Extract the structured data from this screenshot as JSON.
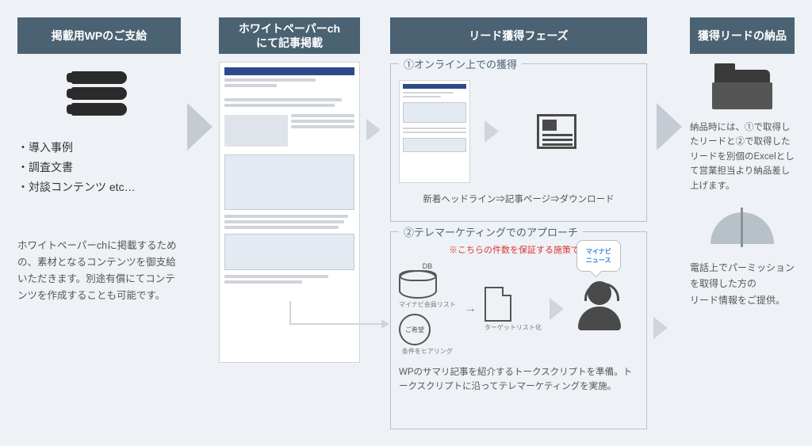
{
  "columns": {
    "c1": {
      "header": "掲載用WPのご支給"
    },
    "c2": {
      "header": "ホワイトペーパーch\nにて記事掲載"
    },
    "c3": {
      "header": "リード獲得フェーズ"
    },
    "c4": {
      "header": "獲得リードの納品"
    }
  },
  "c1_bullets": {
    "b1": "・導入事例",
    "b2": "・調査文書",
    "b3": "・対談コンテンツ etc…"
  },
  "c1_desc": "ホワイトペーパーchに掲載するための、素材となるコンテンツを御支給いただきます。別途有償にてコンテンツを作成することも可能です。",
  "frame1": {
    "title": "①オンライン上での獲得",
    "caption": "新着ヘッドライン⇒記事ページ⇒ダウンロード"
  },
  "frame2": {
    "title": "②テレマーケティングでのアプローチ",
    "note": "※こちらの件数を保証する施策です",
    "db_label": "DB",
    "list_label": "マイナビ会員リスト",
    "circle_label": "ご希望",
    "cond_label": "条件をヒアリング",
    "doc_label": "ターゲットリスト化",
    "bubble": "マイナビ\nニュース",
    "desc": "WPのサマリ記事を紹介するトークスクリプトを準備。トークスクリプトに沿ってテレマーケティングを実施。"
  },
  "c4": {
    "desc_a": "納品時には、①で取得したリードと②で取得したリードを別個のExcelとして営業担当より納品差し上げます。",
    "desc_b": "電話上でパーミッションを取得した方の\nリード情報をご提供。"
  }
}
